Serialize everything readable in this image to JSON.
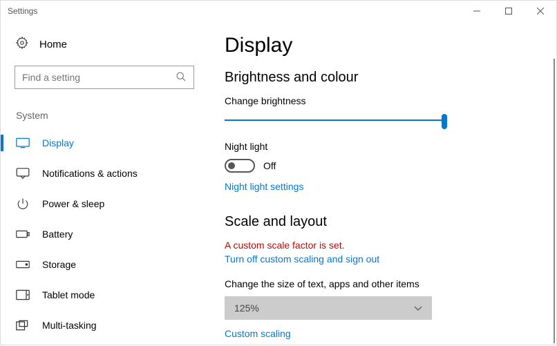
{
  "window": {
    "title": "Settings"
  },
  "sidebar": {
    "home": "Home",
    "search_placeholder": "Find a setting",
    "group": "System",
    "items": [
      {
        "label": "Display",
        "selected": true
      },
      {
        "label": "Notifications & actions"
      },
      {
        "label": "Power & sleep"
      },
      {
        "label": "Battery"
      },
      {
        "label": "Storage"
      },
      {
        "label": "Tablet mode"
      },
      {
        "label": "Multi-tasking"
      }
    ]
  },
  "content": {
    "page_title": "Display",
    "brightness": {
      "heading": "Brightness and colour",
      "slider_label": "Change brightness",
      "slider_value_pct": 98,
      "night_light_label": "Night light",
      "night_light_state": "Off",
      "night_light_link": "Night light settings"
    },
    "scale": {
      "heading": "Scale and layout",
      "warning": "A custom scale factor is set.",
      "turn_off_link": "Turn off custom scaling and sign out",
      "size_label": "Change the size of text, apps and other items",
      "size_value": "125%",
      "custom_link": "Custom scaling"
    }
  }
}
